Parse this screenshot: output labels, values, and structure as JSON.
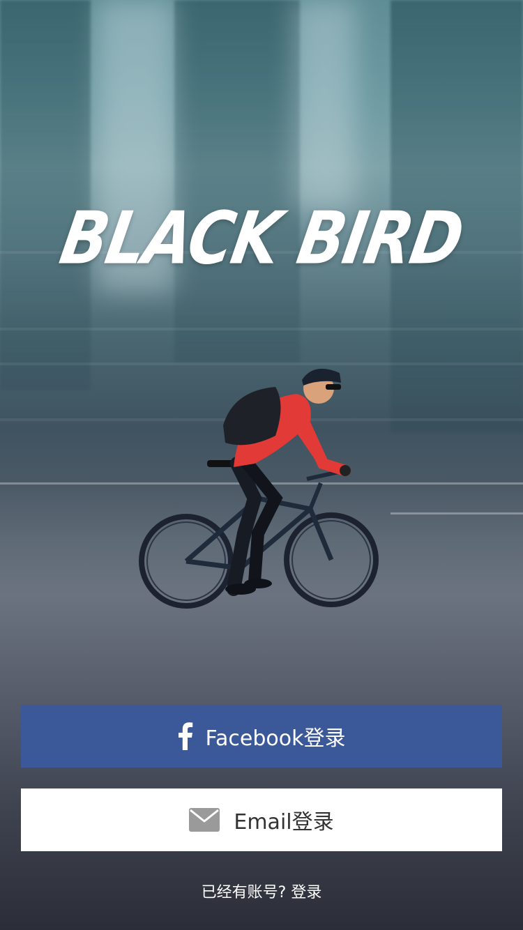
{
  "app": {
    "title": "BLACK BIRD"
  },
  "buttons": {
    "facebook_label": "Facebook登录",
    "email_label": "Email登录"
  },
  "footer": {
    "prompt": "已经有账号?",
    "login_link": "登录"
  },
  "colors": {
    "facebook_blue": "#3b5998",
    "email_bg": "#ffffff",
    "email_text": "#333333",
    "icon_gray": "#9a9a9a"
  },
  "icons": {
    "facebook": "facebook-icon",
    "email": "mail-icon"
  }
}
